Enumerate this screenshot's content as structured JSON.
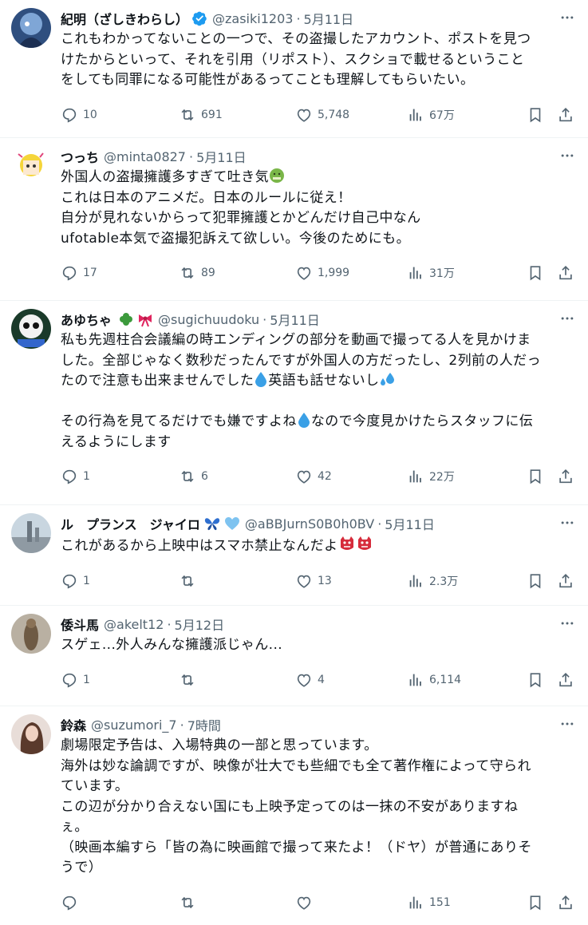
{
  "tweets": [
    {
      "name": "紀明（ざしきわらし）",
      "verified": true,
      "handle": "@zasiki1203",
      "time": "5月11日",
      "lines": [
        "これもわかってないことの一つで、その盗撮したアカウント、ポストを見つ",
        "けたからといって、それを引用（リポスト）、スクショで載せるということ",
        "をしても同罪になる可能性があるってことも理解してもらいたい。"
      ],
      "replies": "10",
      "reposts": "691",
      "likes": "5,748",
      "views": "67万"
    },
    {
      "name": "つっち",
      "handle": "@minta0827",
      "time": "5月11日",
      "lines": [
        "外国人の盗撮擁護多すぎて吐き気",
        "これは日本のアニメだ。日本のルールに従え！",
        "自分が見れないからって犯罪擁護とかどんだけ自己中なん",
        "ufotable本気で盗撮犯訴えて欲しい。今後のためにも。"
      ],
      "replies": "17",
      "reposts": "89",
      "likes": "1,999",
      "views": "31万"
    },
    {
      "name": "あゆちゃ",
      "handle": "@sugichuudoku",
      "time": "5月11日",
      "lines": [
        "私も先週柱合会議編の時エンディングの部分を動画で撮ってる人を見かけま",
        "した。全部じゃなく数秒だったんですが外国人の方だったし、2列前の人だっ",
        "たので注意も出来ませんでした",
        "",
        "その行為を見てるだけでも嫌ですよね",
        "えるようにします"
      ],
      "line_tails": [
        "",
        "",
        "英語も話せないし",
        "",
        "なので今度見かけたらスタッフに伝",
        ""
      ],
      "replies": "1",
      "reposts": "6",
      "likes": "42",
      "views": "22万"
    },
    {
      "name": "ル　プランス　ジャイロ",
      "handle": "@aBBJurnS0B0h0BV",
      "time": "5月11日",
      "lines": [
        "これがあるから上映中はスマホ禁止なんだよ"
      ],
      "replies": "1",
      "reposts": "",
      "likes": "13",
      "views": "2.3万"
    },
    {
      "name": "倭斗馬",
      "handle": "@akelt12",
      "time": "5月12日",
      "lines": [
        "スゲェ...外人みんな擁護派じゃん..."
      ],
      "replies": "1",
      "reposts": "",
      "likes": "4",
      "views": "6,114"
    },
    {
      "name": "鈴森",
      "handle": "@suzumori_7",
      "time": "7時間",
      "lines": [
        "劇場限定予告は、入場特典の一部と思っています。",
        "海外は妙な論調ですが、映像が壮大でも些細でも全て著作権によって守られ",
        "ています。",
        "この辺が分かり合えない国にも上映予定ってのは一抹の不安がありますね",
        "ぇ。",
        "（映画本編すら「皆の為に映画館で撮って来たよ！（ドヤ）が普通にありそ",
        "うで）"
      ],
      "replies": "",
      "reposts": "",
      "likes": "",
      "views": "151"
    }
  ],
  "colors": {
    "text": "#0f1419",
    "muted": "#536471",
    "verified": "#1d9bf0",
    "divider": "#eff3f4"
  },
  "icons": [
    "reply-icon",
    "repost-icon",
    "like-icon",
    "views-icon",
    "bookmark-icon",
    "share-icon",
    "more-icon",
    "verified-icon"
  ]
}
